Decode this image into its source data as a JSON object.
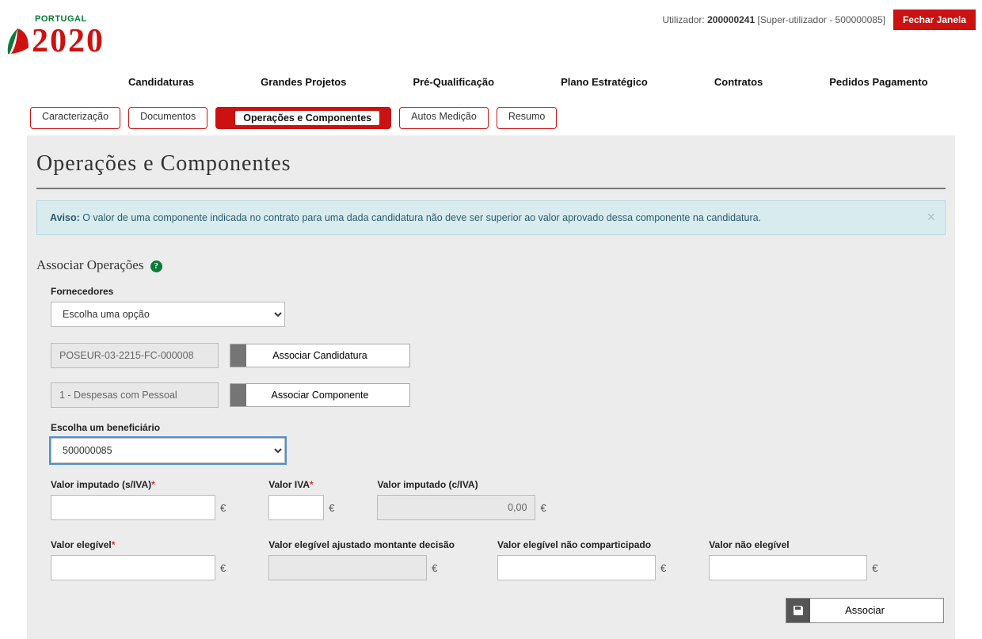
{
  "header": {
    "logo_small": "PORTUGAL",
    "logo_big": "2020",
    "user_label": "Utilizador:",
    "user_id": "200000241",
    "user_role": "[Super-utilizador - 500000085]",
    "close_window": "Fechar Janela"
  },
  "main_nav": [
    "Candidaturas",
    "Grandes Projetos",
    "Pré-Qualificação",
    "Plano Estratégico",
    "Contratos",
    "Pedidos Pagamento"
  ],
  "tabs": [
    {
      "label": "Caracterização",
      "active": false
    },
    {
      "label": "Documentos",
      "active": false
    },
    {
      "label": "Operações e Componentes",
      "active": true
    },
    {
      "label": "Autos Medição",
      "active": false
    },
    {
      "label": "Resumo",
      "active": false
    }
  ],
  "page_title": "Operações e Componentes",
  "alert": {
    "prefix": "Aviso:",
    "text": " O valor de uma componente indicada no contrato para uma dada candidatura não deve ser superior ao valor aprovado dessa componente na candidatura."
  },
  "section_title": "Associar Operações",
  "form": {
    "fornecedores_label": "Fornecedores",
    "fornecedores_placeholder": "Escolha uma opção",
    "candidatura_value": "POSEUR-03-2215-FC-000008",
    "btn_assoc_candidatura": "Associar Candidatura",
    "componente_value": "1 - Despesas com Pessoal",
    "btn_assoc_componente": "Associar Componente",
    "beneficiario_label": "Escolha um beneficiário",
    "beneficiario_value": "500000085"
  },
  "money_fields": {
    "valor_imputado_siva_label": "Valor imputado (s/IVA)",
    "valor_iva_label": "Valor IVA",
    "valor_imputado_civa_label": "Valor imputado (c/IVA)",
    "valor_imputado_civa_value": "0,00",
    "valor_elegivel_label": "Valor elegível",
    "valor_elegivel_ajustado_label": "Valor elegível ajustado montante decisão",
    "valor_elegivel_nao_comparticipado_label": "Valor elegível não comparticipado",
    "valor_nao_elegivel_label": "Valor não elegível",
    "currency": "€"
  },
  "actions": {
    "associar": "Associar"
  }
}
